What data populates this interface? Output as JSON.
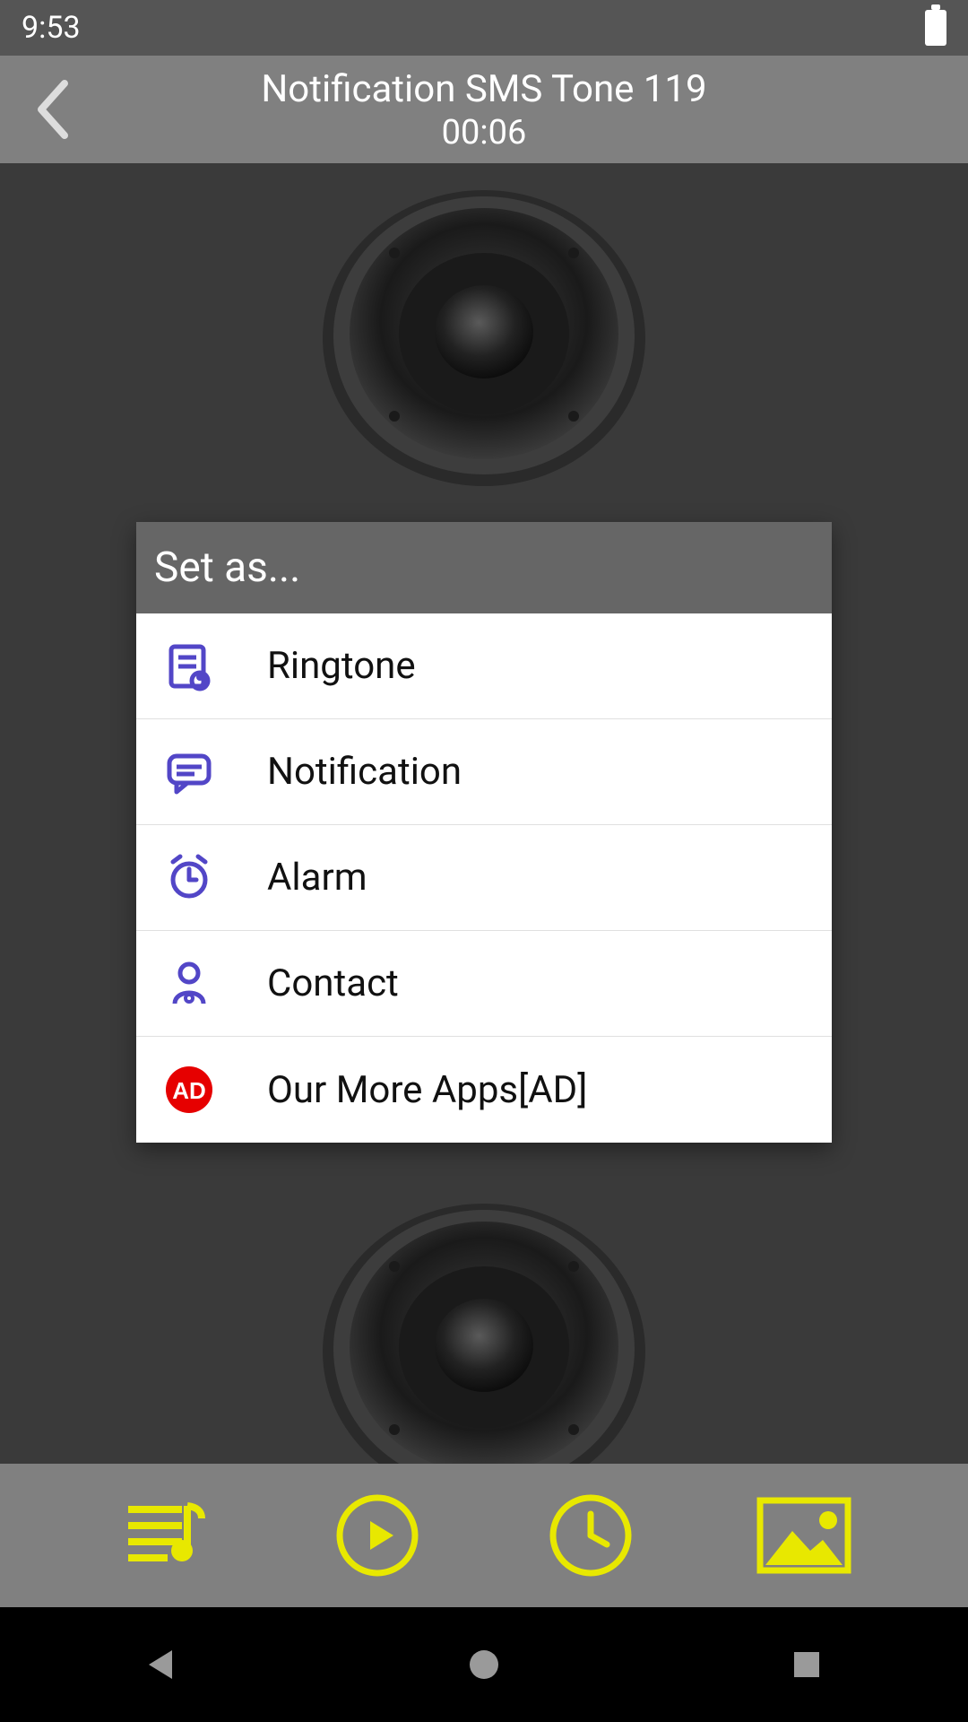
{
  "status": {
    "time": "9:53"
  },
  "header": {
    "title": "Notification SMS Tone 119",
    "duration": "00:06"
  },
  "dialog": {
    "title": "Set as...",
    "items": [
      {
        "label": "Ringtone",
        "icon": "ringtone-icon"
      },
      {
        "label": "Notification",
        "icon": "notification-icon"
      },
      {
        "label": "Alarm",
        "icon": "alarm-icon"
      },
      {
        "label": "Contact",
        "icon": "contact-icon"
      },
      {
        "label": "Our More Apps[AD]",
        "icon": "ad-icon"
      }
    ]
  },
  "bottom": {
    "buttons": [
      "playlist",
      "play",
      "clock",
      "image"
    ]
  },
  "colors": {
    "accent_purple": "#5246c7",
    "accent_yellow": "#e8e800",
    "ad_red": "#e60000"
  }
}
